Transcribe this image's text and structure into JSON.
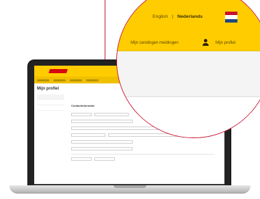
{
  "header": {
    "language_english": "English",
    "language_separator": "|",
    "language_dutch": "Nederlands"
  },
  "nav": {
    "shipments_link": "Mijn zendingen meldingen",
    "profile_link": "Mijn profiel"
  },
  "screen": {
    "page_title": "Mijn profiel",
    "section_heading": "Contactinformatie"
  },
  "colors": {
    "brand_yellow": "#ffcc00",
    "brand_red": "#d40511",
    "flag_red": "#c8102e",
    "flag_blue": "#1e4785"
  }
}
